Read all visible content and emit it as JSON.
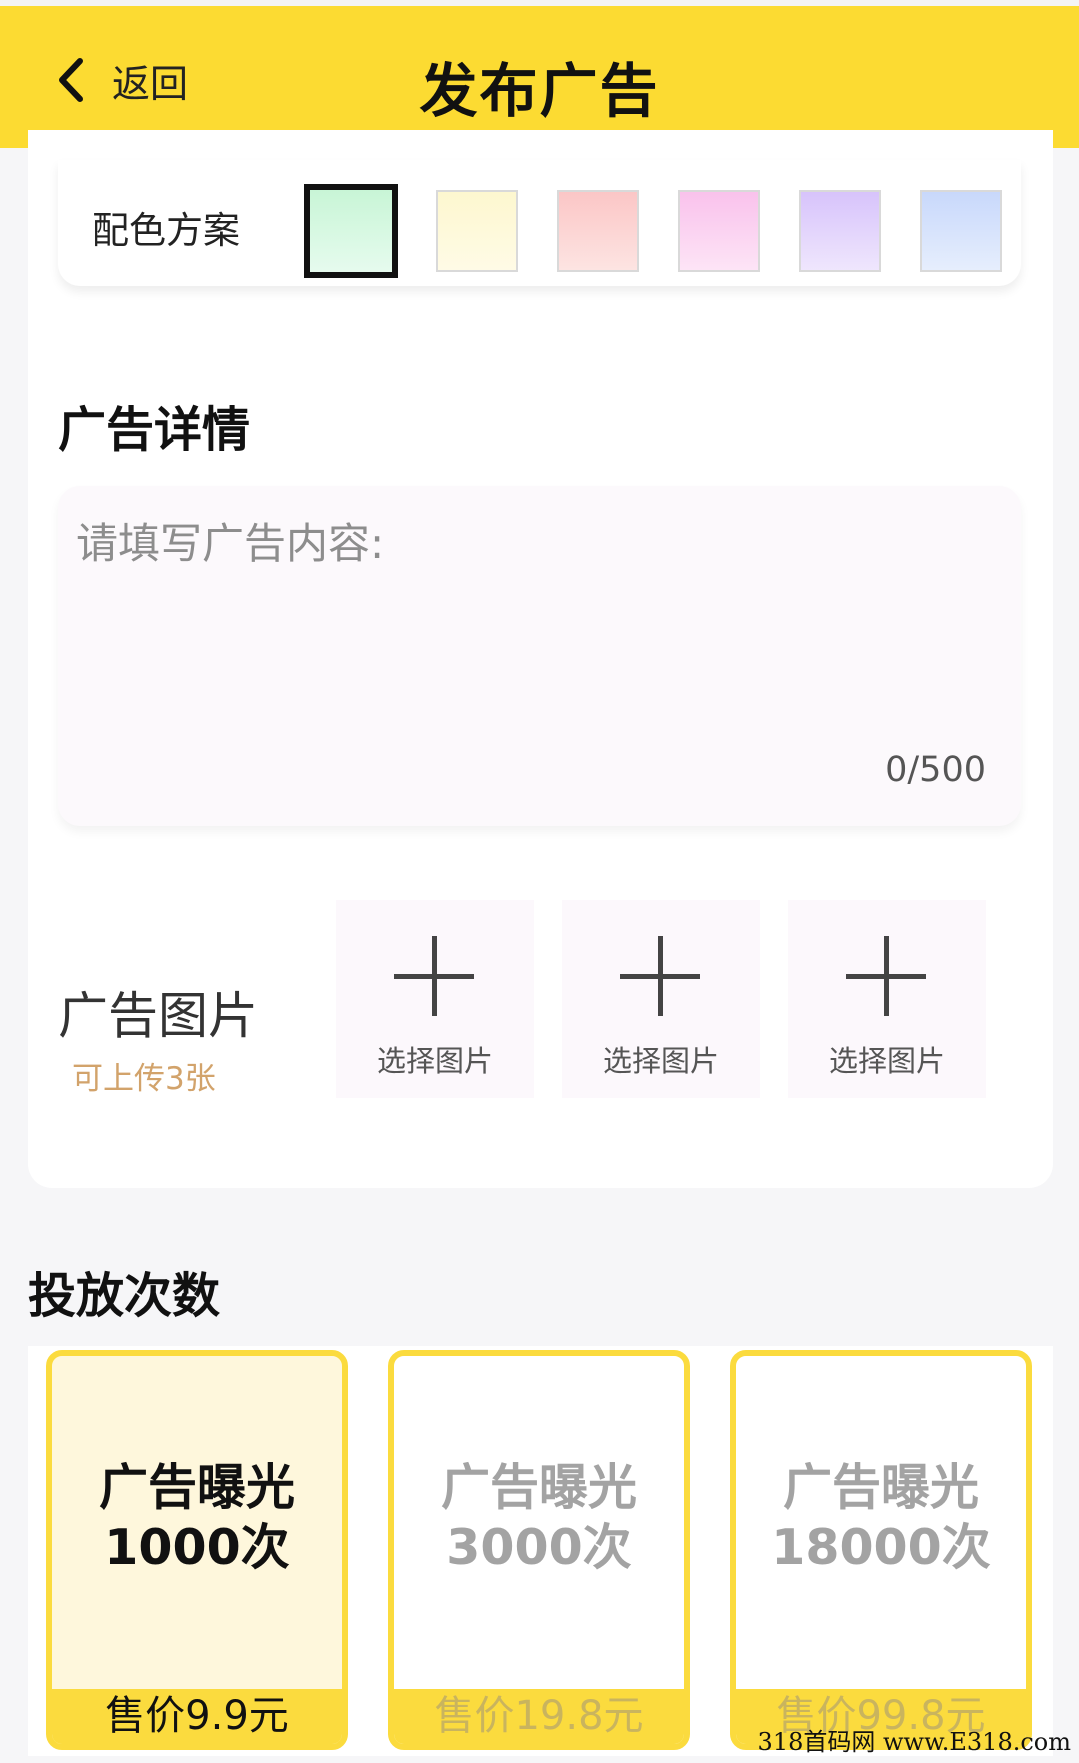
{
  "header": {
    "back_label": "返回",
    "title": "发布广告"
  },
  "color_scheme": {
    "label": "配色方案",
    "swatches": [
      {
        "from": "#c8f5d6",
        "to": "#e6fbee",
        "selected": true
      },
      {
        "from": "#fdf7cf",
        "to": "#fffbe6",
        "selected": false
      },
      {
        "from": "#fbc6c6",
        "to": "#fde4e2",
        "selected": false
      },
      {
        "from": "#f9c2ec",
        "to": "#fde4f6",
        "selected": false
      },
      {
        "from": "#d7c3fb",
        "to": "#efe6fd",
        "selected": false
      },
      {
        "from": "#c8d8fb",
        "to": "#e6eefd",
        "selected": false
      }
    ]
  },
  "details": {
    "title": "广告详情",
    "placeholder": "请填写广告内容:",
    "counter": "0/500"
  },
  "images": {
    "label": "广告图片",
    "sublabel": "可上传3张",
    "slots": [
      {
        "label": "选择图片"
      },
      {
        "label": "选择图片"
      },
      {
        "label": "选择图片"
      }
    ]
  },
  "packages": {
    "title": "投放次数",
    "items": [
      {
        "name": "广告曝光",
        "count": "1000次",
        "price": "售价9.9元",
        "selected": true
      },
      {
        "name": "广告曝光",
        "count": "3000次",
        "price": "售价19.8元",
        "selected": false
      },
      {
        "name": "广告曝光",
        "count": "18000次",
        "price": "售价99.8元",
        "selected": false
      }
    ]
  },
  "watermark": "318首码网 www.E318.com"
}
